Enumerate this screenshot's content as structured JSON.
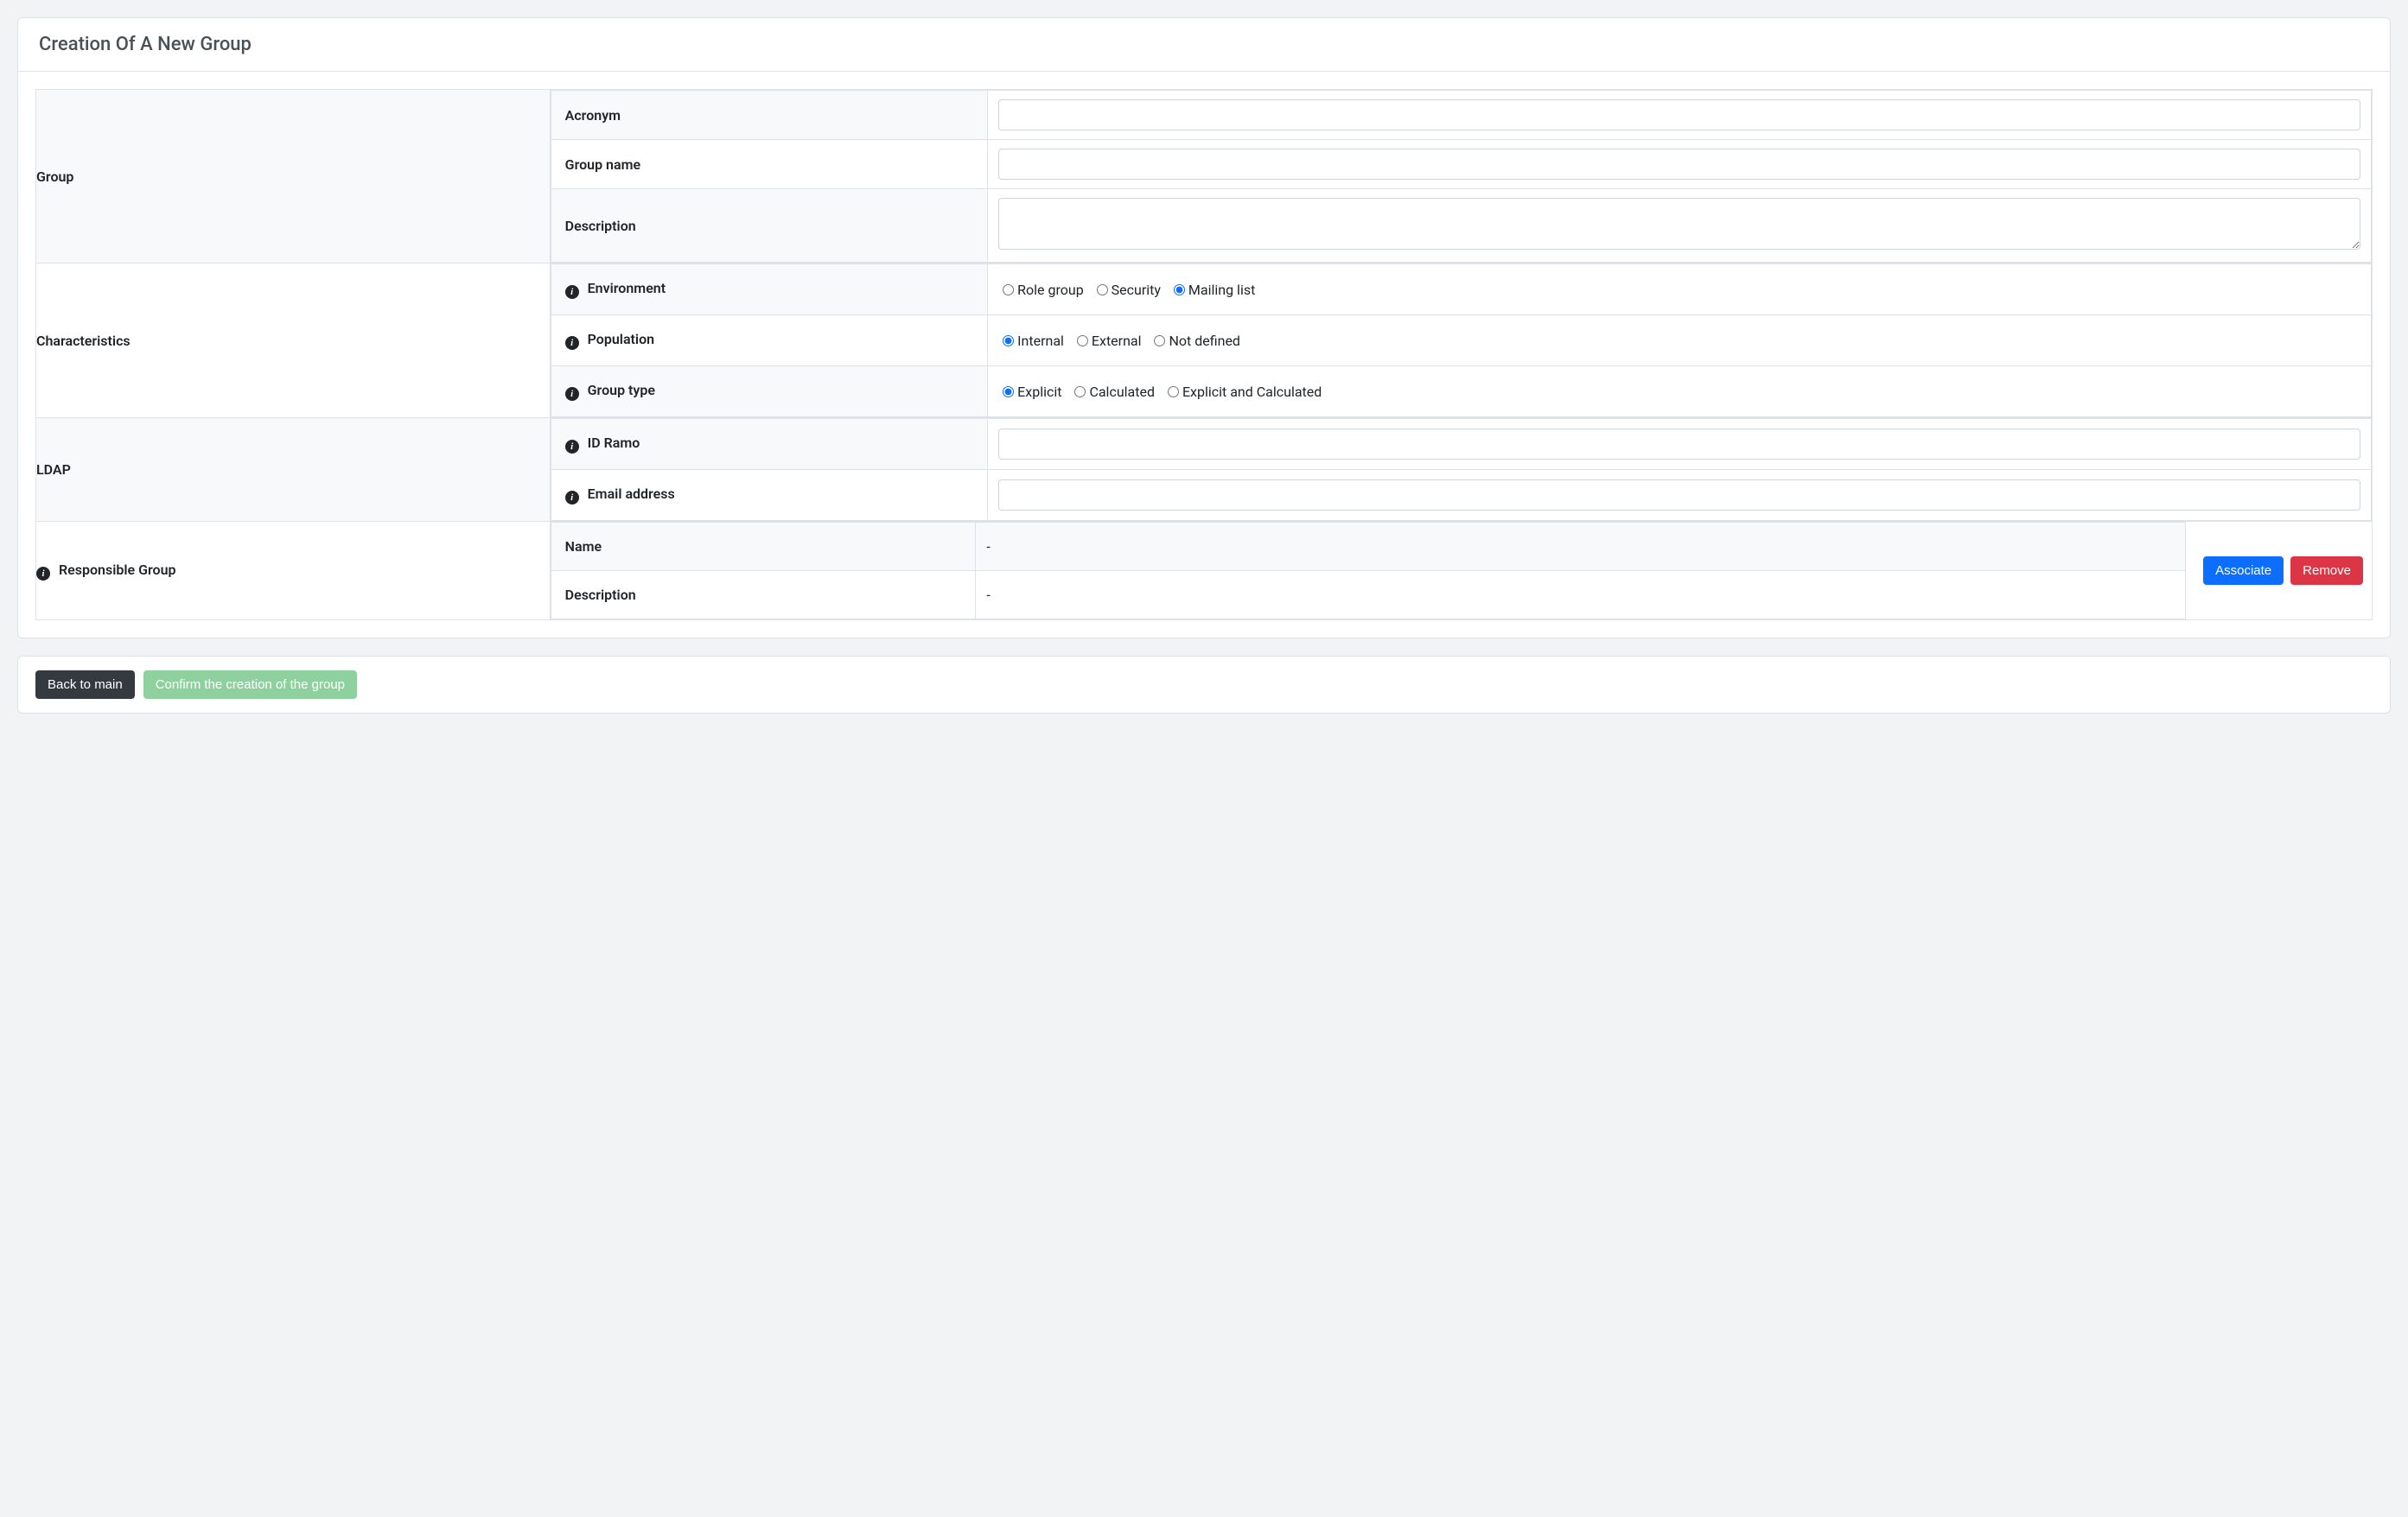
{
  "page_title": "Creation Of A New Group",
  "sections": {
    "group": {
      "label": "Group",
      "fields": {
        "acronym_label": "Acronym",
        "acronym_value": "",
        "name_label": "Group name",
        "name_value": "",
        "desc_label": "Description",
        "desc_value": ""
      }
    },
    "characteristics": {
      "label": "Characteristics",
      "environment": {
        "label": "Environment",
        "options": {
          "role": "Role group",
          "security": "Security",
          "mailing": "Mailing list"
        },
        "selected": "mailing"
      },
      "population": {
        "label": "Population",
        "options": {
          "internal": "Internal",
          "external": "External",
          "not_defined": "Not defined"
        },
        "selected": "internal"
      },
      "group_type": {
        "label": "Group type",
        "options": {
          "explicit": "Explicit",
          "calculated": "Calculated",
          "both": "Explicit and Calculated"
        },
        "selected": "explicit"
      }
    },
    "ldap": {
      "label": "LDAP",
      "id_ramo_label": "ID Ramo",
      "id_ramo_value": "",
      "email_label": "Email address",
      "email_value": ""
    },
    "responsible": {
      "label": "Responsible Group",
      "name_label": "Name",
      "name_value": "-",
      "desc_label": "Description",
      "desc_value": "-",
      "associate_btn": "Associate",
      "remove_btn": "Remove"
    }
  },
  "footer": {
    "back_btn": "Back to main",
    "confirm_btn": "Confirm the creation of the group"
  }
}
